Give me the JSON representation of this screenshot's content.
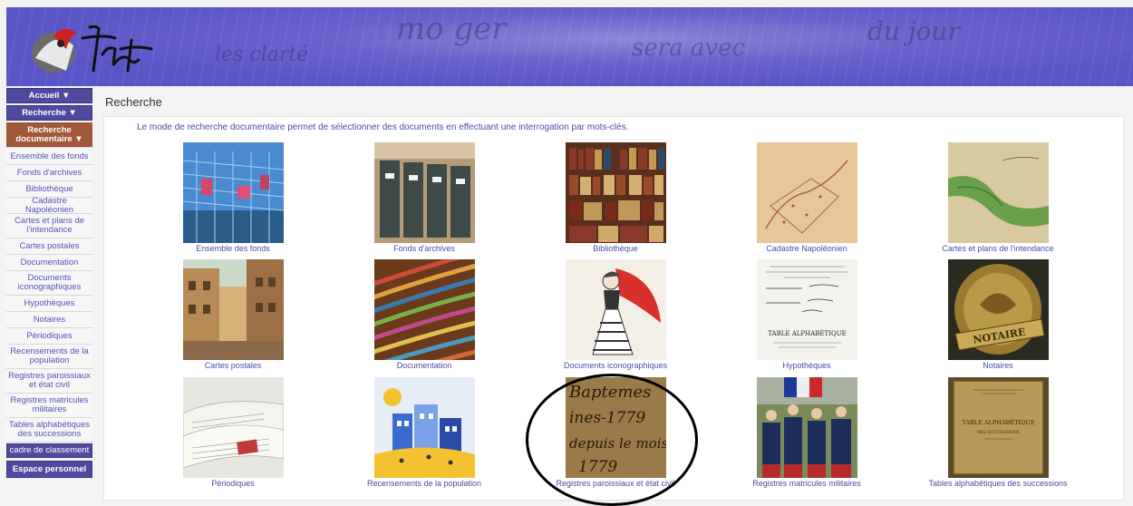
{
  "page": {
    "title": "Recherche"
  },
  "sidebar": {
    "accueil": "Accueil ▼",
    "recherche": "Recherche ▼",
    "recherche_doc": "Recherche documentaire ▼",
    "items": [
      "Ensemble des fonds",
      "Fonds d'archives",
      "Bibliothèque",
      "Cadastre Napoléonien",
      "Cartes et plans de l'intendance",
      "Cartes postales",
      "Documentation",
      "Documents iconographiques",
      "Hypothèques",
      "Notaires",
      "Périodiques",
      "Recensements de la population",
      "Registres paroissiaux et état civil",
      "Registres matricules militaires",
      "Tables alphabétiques des successions"
    ],
    "cadre": "cadre de classement",
    "espace": "Espace personnel"
  },
  "main": {
    "intro": "Le mode de recherche documentaire permet de sélectionner des documents en effectuant une interrogation par mots-clés.",
    "tiles": [
      "Ensemble des fonds",
      "Fonds d'archives",
      "Bibliothèque",
      "Cadastre Napoléonien",
      "Cartes et plans de l'intendance",
      "Cartes postales",
      "Documentation",
      "Documents iconographiques",
      "Hypothèques",
      "Notaires",
      "Périodiques",
      "Recensements de la population",
      "Registres paroissiaux et état civil",
      "Registres matricules militaires",
      "Tables alphabétiques des successions"
    ],
    "thumb_text": {
      "hypotheques_heading": "TABLE ALPHABÉTIQUE",
      "notaires_word": "NOTAIRE",
      "registres_lines": [
        "Baptemes",
        "ines-1779",
        "depuis le mois",
        "1779"
      ],
      "tables_heading": "TABLE ALPHABÉTIQUE",
      "tables_sub": "DES SUCCESSIONS"
    }
  },
  "colors": {
    "banner": "#5a55c8",
    "nav_dark": "#4f4a9e",
    "nav_active": "#a1583a",
    "link": "#4b4aa8"
  }
}
